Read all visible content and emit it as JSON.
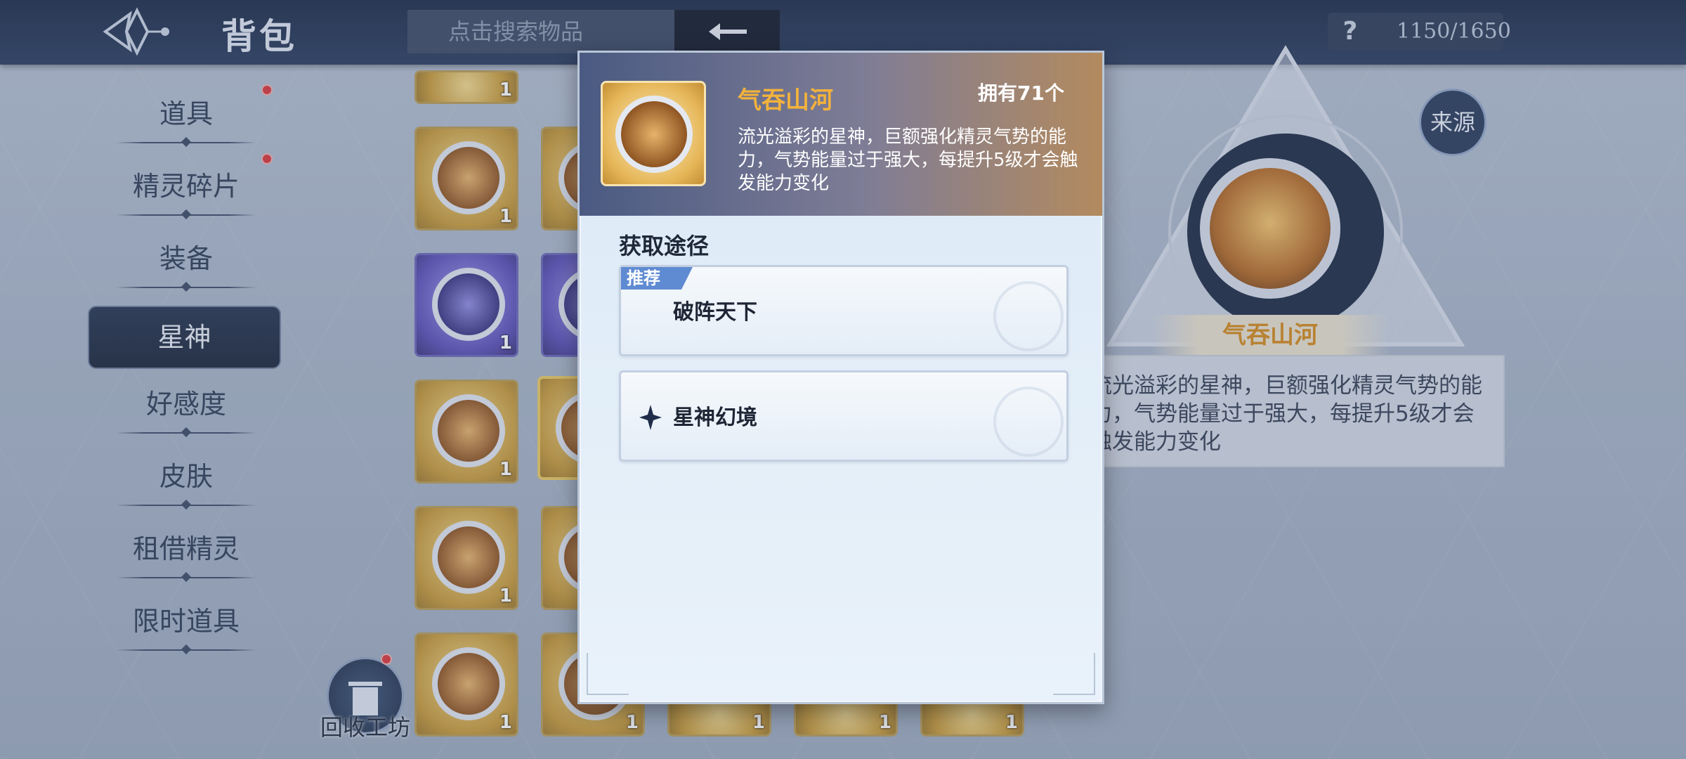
{
  "header": {
    "title": "背包",
    "search_placeholder": "点击搜索物品",
    "help_icon": "?",
    "capacity": "1150/1650"
  },
  "sidebar": {
    "items": [
      {
        "label": "道具",
        "badge": true
      },
      {
        "label": "精灵碎片",
        "badge": true
      },
      {
        "label": "装备",
        "badge": false
      },
      {
        "label": "星神",
        "badge": false,
        "active": true
      },
      {
        "label": "好感度",
        "badge": false
      },
      {
        "label": "皮肤",
        "badge": false
      },
      {
        "label": "租借精灵",
        "badge": false
      },
      {
        "label": "限时道具",
        "badge": false
      }
    ]
  },
  "grid": {
    "counts": [
      "1",
      "1",
      "1",
      "1",
      "1",
      "1",
      "1",
      "1",
      "1",
      "1"
    ]
  },
  "recycle": {
    "label": "回收工坊"
  },
  "detail": {
    "source_button": "来源",
    "name": "气吞山河",
    "description": "流光溢彩的星神，巨额强化精灵气势的能力，气势能量过于强大，每提升5级才会触发能力变化"
  },
  "modal": {
    "name": "气吞山河",
    "owned": "拥有71个",
    "description": "流光溢彩的星神，巨额强化精灵气势的能力，气势能量过于强大，每提升5级才会触发能力变化",
    "section_title": "获取途径",
    "routes": [
      {
        "tag": "推荐",
        "label": "破阵天下"
      },
      {
        "tag": "",
        "label": "星神幻境"
      }
    ]
  },
  "colors": {
    "topbar": "#1d2c48",
    "accent_gold": "#f3b23c",
    "badge_red": "#d8363b",
    "tag_blue": "#5f8bd2"
  }
}
